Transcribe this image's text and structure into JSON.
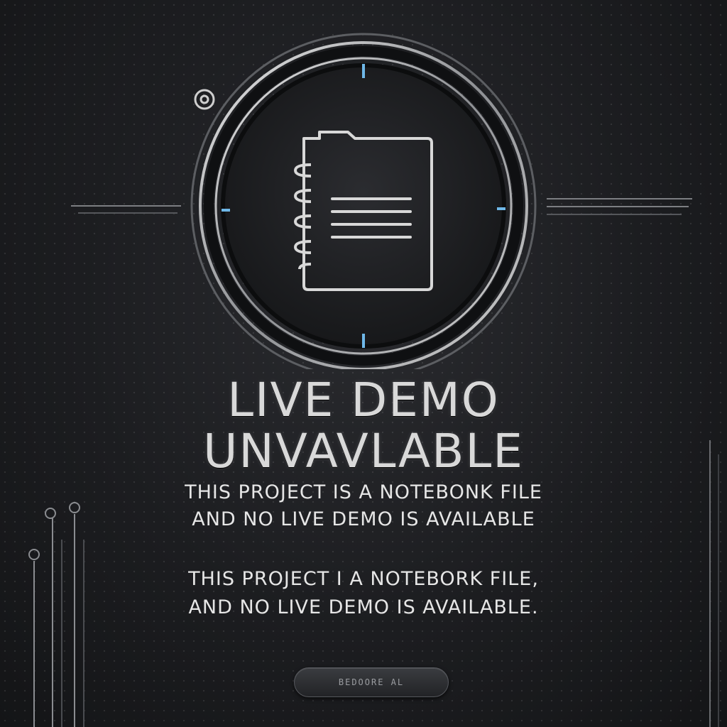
{
  "headline": {
    "line1": "LIVE DEMO",
    "line2": "UNVAVLABLE"
  },
  "message_primary": {
    "line1": "THIS PROJECT IS A NOTEBONK FILE",
    "line2": "AND NO LIVE DEMO IS AVAILABLE"
  },
  "message_secondary": {
    "line1": "THIS PROJECT I A NOTEBORK FILE,",
    "line2": "AND NO LIVE DEMO IS AVAILABLE."
  },
  "button": {
    "label": "BEDOORE AL"
  },
  "icons": {
    "center": "notebook-icon",
    "corner": "copyright-icon"
  },
  "colors": {
    "background": "#1e1f22",
    "text": "#d9d9d9",
    "accent": "#6fb8e8"
  }
}
